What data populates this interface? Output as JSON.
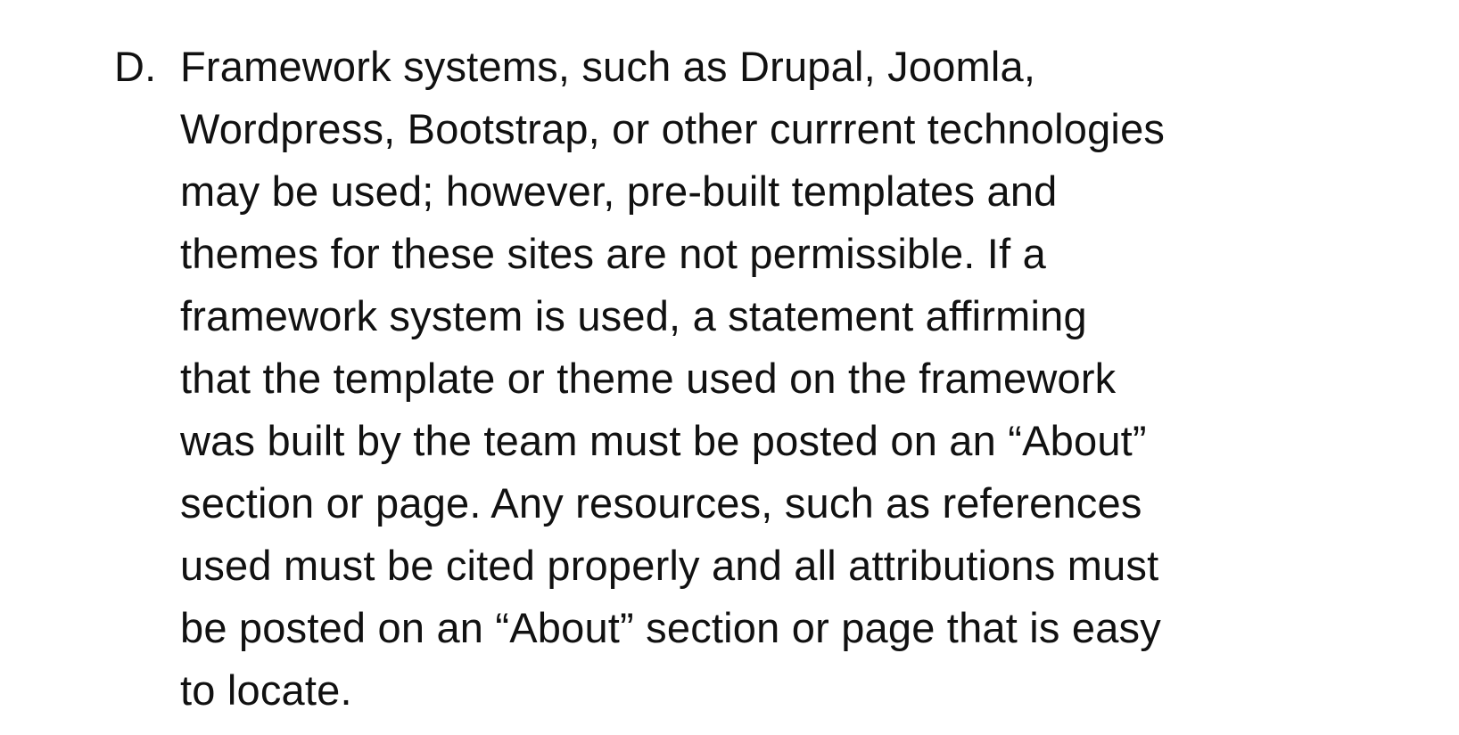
{
  "item": {
    "marker": "D.",
    "lines": [
      "Framework systems, such as Drupal, Joomla,",
      "Wordpress, Bootstrap, or other currrent technologies",
      "may be used; however, pre-built templates and",
      "themes for these sites are not permissible. If a",
      "framework system is used, a statement affirming",
      "that the template or theme used on the framework",
      "was built by the team must be posted on an “About”",
      "section or page. Any resources, such as references",
      "used must be cited properly and all attributions must",
      "be posted on an “About” section or page that is easy",
      "to locate."
    ]
  },
  "colors": {
    "background": "#ffffff",
    "text": "#111111"
  }
}
